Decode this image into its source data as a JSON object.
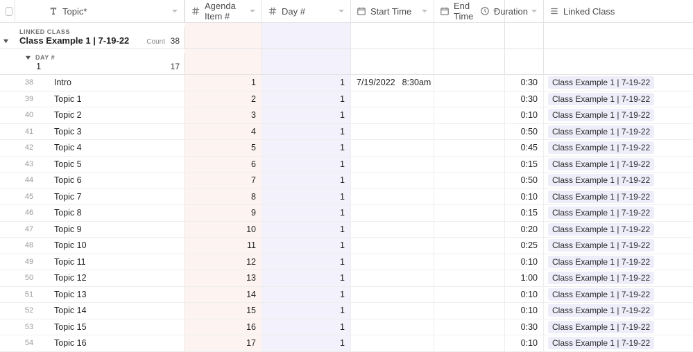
{
  "columns": {
    "topic": "Topic*",
    "agenda": "Agenda Item #",
    "day": "Day #",
    "start": "Start Time",
    "end": "End Time",
    "duration": "Duration",
    "linked": "Linked Class"
  },
  "group1": {
    "label": "LINKED CLASS",
    "title": "Class Example 1 | 7-19-22",
    "count_label": "Count",
    "count_value": "38"
  },
  "group2": {
    "label": "DAY #",
    "title": "1",
    "count_value": "17"
  },
  "linked_chip": "Class Example 1 | 7-19-22",
  "rows": [
    {
      "n": "38",
      "topic": "Intro",
      "agenda": "1",
      "day": "1",
      "start_date": "7/19/2022",
      "start_time": "8:30am",
      "dur": "0:30"
    },
    {
      "n": "39",
      "topic": "Topic 1",
      "agenda": "2",
      "day": "1",
      "start_date": "",
      "start_time": "",
      "dur": "0:30"
    },
    {
      "n": "40",
      "topic": "Topic 2",
      "agenda": "3",
      "day": "1",
      "start_date": "",
      "start_time": "",
      "dur": "0:10"
    },
    {
      "n": "41",
      "topic": "Topic 3",
      "agenda": "4",
      "day": "1",
      "start_date": "",
      "start_time": "",
      "dur": "0:50"
    },
    {
      "n": "42",
      "topic": "Topic 4",
      "agenda": "5",
      "day": "1",
      "start_date": "",
      "start_time": "",
      "dur": "0:45"
    },
    {
      "n": "43",
      "topic": "Topic 5",
      "agenda": "6",
      "day": "1",
      "start_date": "",
      "start_time": "",
      "dur": "0:15"
    },
    {
      "n": "44",
      "topic": "Topic 6",
      "agenda": "7",
      "day": "1",
      "start_date": "",
      "start_time": "",
      "dur": "0:50"
    },
    {
      "n": "45",
      "topic": "Topic 7",
      "agenda": "8",
      "day": "1",
      "start_date": "",
      "start_time": "",
      "dur": "0:10"
    },
    {
      "n": "46",
      "topic": "Topic 8",
      "agenda": "9",
      "day": "1",
      "start_date": "",
      "start_time": "",
      "dur": "0:15"
    },
    {
      "n": "47",
      "topic": "Topic 9",
      "agenda": "10",
      "day": "1",
      "start_date": "",
      "start_time": "",
      "dur": "0:20"
    },
    {
      "n": "48",
      "topic": "Topic 10",
      "agenda": "11",
      "day": "1",
      "start_date": "",
      "start_time": "",
      "dur": "0:25"
    },
    {
      "n": "49",
      "topic": "Topic 11",
      "agenda": "12",
      "day": "1",
      "start_date": "",
      "start_time": "",
      "dur": "0:10"
    },
    {
      "n": "50",
      "topic": "Topic 12",
      "agenda": "13",
      "day": "1",
      "start_date": "",
      "start_time": "",
      "dur": "1:00"
    },
    {
      "n": "51",
      "topic": "Topic 13",
      "agenda": "14",
      "day": "1",
      "start_date": "",
      "start_time": "",
      "dur": "0:10"
    },
    {
      "n": "52",
      "topic": "Topic 14",
      "agenda": "15",
      "day": "1",
      "start_date": "",
      "start_time": "",
      "dur": "0:10"
    },
    {
      "n": "53",
      "topic": "Topic 15",
      "agenda": "16",
      "day": "1",
      "start_date": "",
      "start_time": "",
      "dur": "0:30"
    },
    {
      "n": "54",
      "topic": "Topic 16",
      "agenda": "17",
      "day": "1",
      "start_date": "",
      "start_time": "",
      "dur": "0:10"
    }
  ]
}
